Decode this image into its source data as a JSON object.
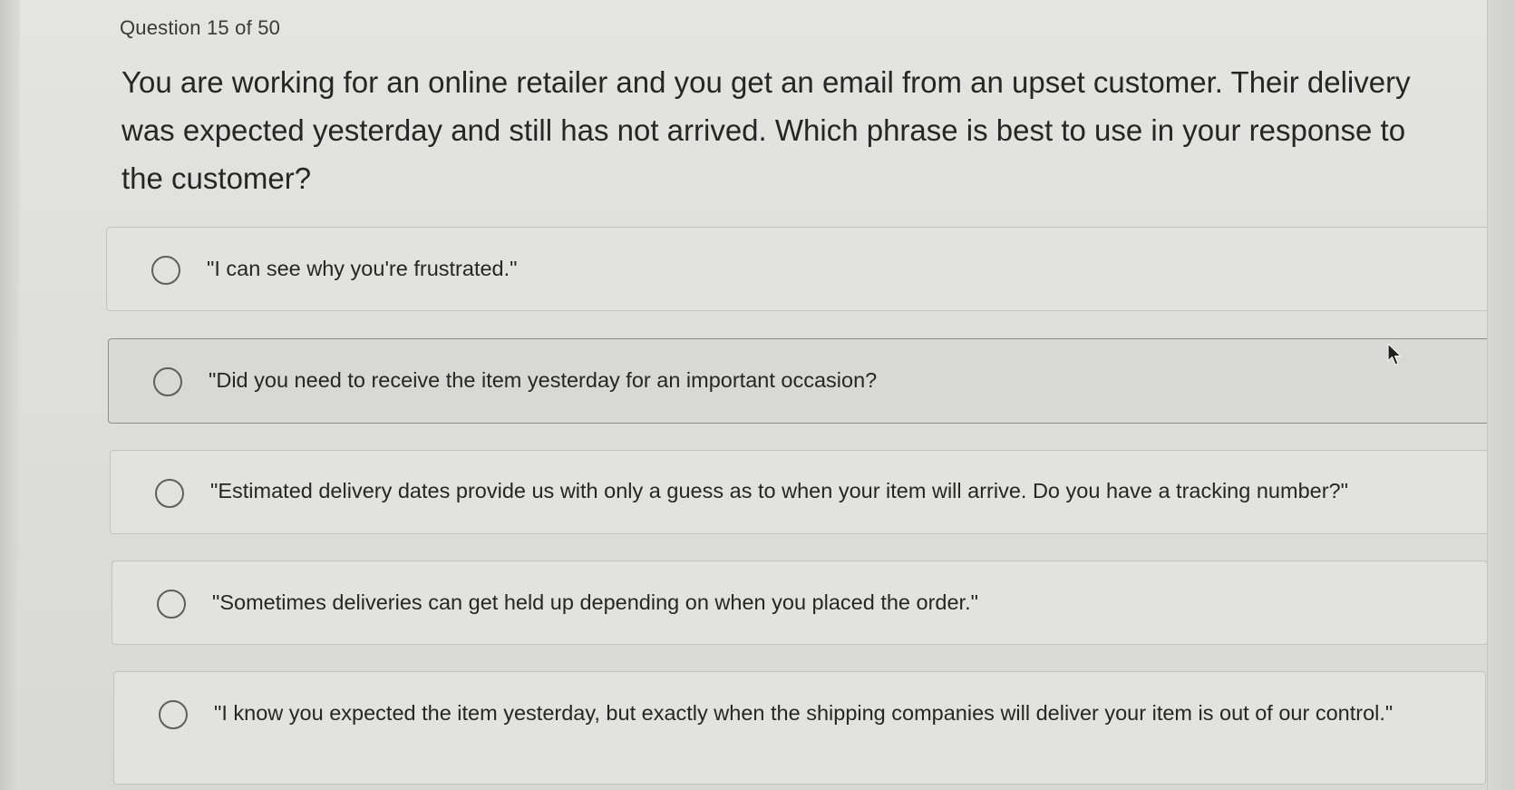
{
  "question": {
    "counter": "Question 15 of 50",
    "text": "You are working for an online retailer and you get an email from an upset customer. Their delivery was expected yesterday and still has not arrived. Which phrase is best to use in your response to the customer?"
  },
  "options": [
    {
      "label": "\"I can see why you're frustrated.\"",
      "selected": false
    },
    {
      "label": "\"Did you need to receive the item yesterday for an important occasion?",
      "selected": false
    },
    {
      "label": "\"Estimated delivery dates provide us with only a guess as to when your item will arrive. Do you have a tracking number?\"",
      "selected": false
    },
    {
      "label": "\"Sometimes deliveries can get held up depending on when you placed the order.\"",
      "selected": false
    },
    {
      "label": "\"I know you expected the item yesterday, but exactly when the shipping companies will deliver your item is out of our control.\"",
      "selected": false
    }
  ],
  "icons": {
    "radio": "radio-circle-icon",
    "cursor": "mouse-pointer-icon"
  }
}
